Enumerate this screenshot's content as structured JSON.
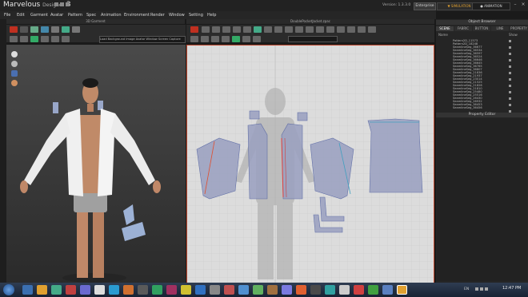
{
  "app": {
    "name": "Marvelous",
    "name_suffix": "Designer",
    "major_version": "3",
    "version_label": "Version:",
    "version_number": "1.3.3.0",
    "edition": "Enterprise",
    "mode_simulation": "SIMULATION",
    "mode_animation": "ANIMATION"
  },
  "menu": [
    "File",
    "Edit",
    "Garment",
    "Avatar",
    "Pattern",
    "Spec",
    "Animation",
    "Environment",
    "Render",
    "Window",
    "Setting",
    "Help"
  ],
  "panes": {
    "view3d_title": "3D Garment",
    "view2d_title": "DoublePocketJacket.zpac",
    "pane3d_field": "Load Background Image  Avatar  Window  Screen Capture"
  },
  "object_browser": {
    "title": "Object Browser",
    "tabs": [
      "SCENE",
      "FABRIC",
      "BUTTON",
      "LINE",
      "PROPERTY"
    ],
    "col_name": "Name",
    "col_show": "Show",
    "items": [
      "Pattern2D_11573",
      "Pattern2D_18248",
      "SeamlineSeg_36677",
      "SeamlineSeg_36534",
      "SeamlineSeg_36597",
      "SeamlineSeg_36524",
      "SeamlineSeg_36646",
      "SeamlineSeg_36645",
      "SeamlineSeg_36765",
      "SeamlineSeg_36807",
      "SeamlineSeg_21836",
      "SeamlineSeg_21937",
      "SeamlineSeg_23014",
      "SeamlineSeg_21525",
      "SeamlineSeg_21826",
      "SeamlineSeg_21810",
      "SeamlineSeg_25480",
      "SeamlineSeg_25516",
      "SeamlineSeg_26430",
      "SeamlineSeg_26932",
      "SeamlineSeg_36453",
      "SeamlineSeg_36456"
    ]
  },
  "property_editor": {
    "title": "Property Editor"
  },
  "taskbar": {
    "lang": "EN",
    "time": "12:47 PM"
  },
  "colors": {
    "accent_orange": "#e0a030",
    "canvas": "#dcdcdc",
    "pattern_fill": "#9aa0c0",
    "panel": "#252525"
  }
}
